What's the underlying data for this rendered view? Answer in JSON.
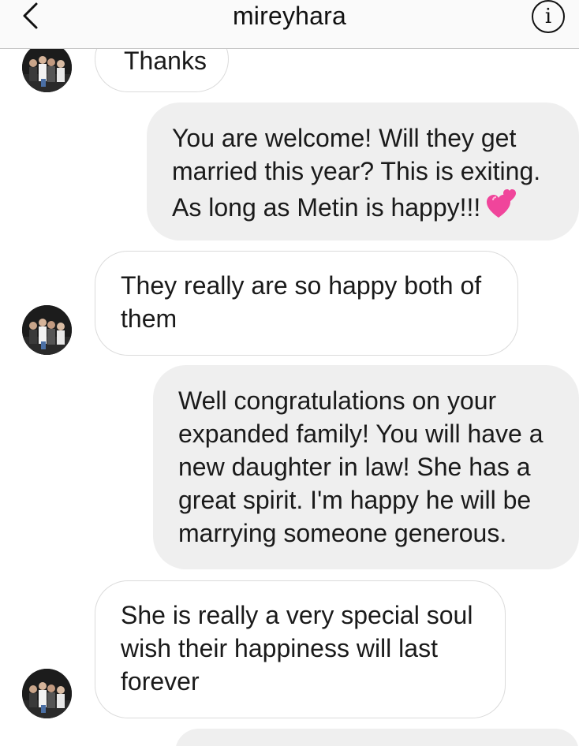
{
  "header": {
    "title": "mireyhara",
    "back_icon": "chevron-left-icon",
    "info_icon": "info-icon",
    "info_glyph": "i"
  },
  "messages": [
    {
      "sender": "them",
      "text": "Thanks"
    },
    {
      "sender": "me",
      "text": "You are welcome! Will they get\nmarried this year? This is exiting.\nAs long as Metin is happy!!!",
      "emoji": "two-hearts-icon"
    },
    {
      "sender": "them",
      "text": "They really are so happy both of\nthem"
    },
    {
      "sender": "me",
      "text": "Well congratulations on your\nexpanded family! You will have a\nnew daughter in law! She has a\ngreat spirit. I'm happy he will be\nmarrying someone generous."
    },
    {
      "sender": "them",
      "text": "She is really a very special soul\nwish their happiness will last\nforever"
    },
    {
      "sender": "me",
      "text": ""
    }
  ],
  "colors": {
    "incoming_bubble": "#ffffff",
    "outgoing_bubble": "#efefef",
    "bubble_border": "#dbdbdb",
    "heart": "#f0459b"
  }
}
